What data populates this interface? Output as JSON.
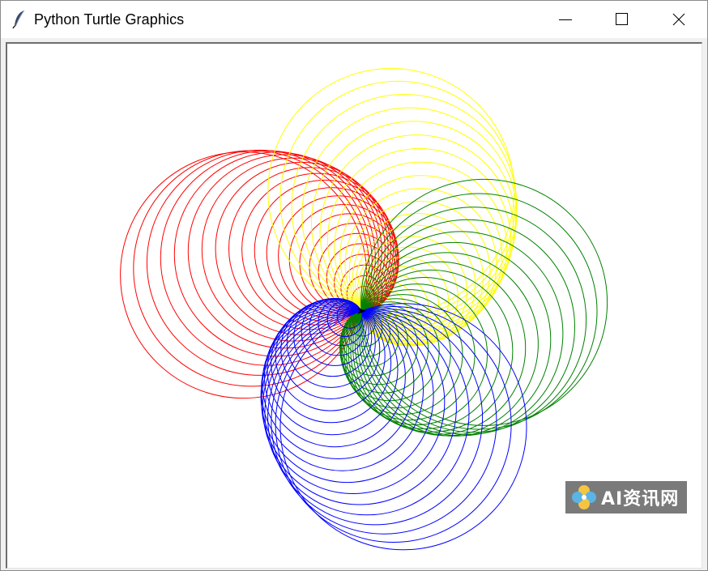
{
  "window": {
    "title": "Python Turtle Graphics",
    "app_icon": "feather-icon"
  },
  "window_controls": [
    {
      "name": "minimize",
      "icon": "minimize-icon"
    },
    {
      "name": "maximize",
      "icon": "maximize-icon"
    },
    {
      "name": "close",
      "icon": "close-icon"
    }
  ],
  "canvas": {
    "background": "#ffffff",
    "drawing": "four-color spirograph of overlapping circles",
    "colors": [
      "#ff0000",
      "#ffff00",
      "#008000",
      "#0000ff"
    ]
  },
  "watermark": {
    "text": "AI资讯网"
  }
}
